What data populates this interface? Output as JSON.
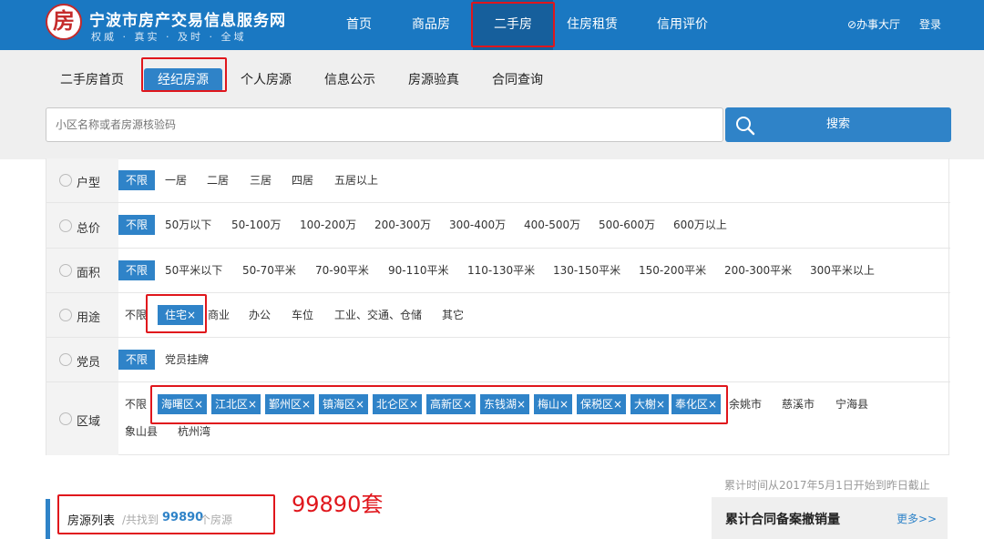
{
  "header": {
    "site_title": "宁波市房产交易信息服务网",
    "site_subtitle": "权威 · 真实 · 及时 · 全域",
    "logo_glyph": "房",
    "nav": [
      "首页",
      "商品房",
      "二手房",
      "住房租赁",
      "信用评价"
    ],
    "active_nav": "二手房",
    "office_hall": "⊘办事大厅",
    "login": "登录"
  },
  "subnav": {
    "items": [
      "二手房首页",
      "经纪房源",
      "个人房源",
      "信息公示",
      "房源验真",
      "合同查询"
    ],
    "active": "经纪房源"
  },
  "search": {
    "placeholder": "小区名称或者房源核验码",
    "button": "搜索"
  },
  "filters": {
    "huxing": {
      "label": "户型",
      "options": [
        "不限",
        "一居",
        "二居",
        "三居",
        "四居",
        "五居以上"
      ],
      "selected": "不限"
    },
    "price": {
      "label": "总价",
      "options": [
        "不限",
        "50万以下",
        "50-100万",
        "100-200万",
        "200-300万",
        "300-400万",
        "400-500万",
        "500-600万",
        "600万以上"
      ],
      "selected": "不限"
    },
    "area": {
      "label": "面积",
      "options": [
        "不限",
        "50平米以下",
        "50-70平米",
        "70-90平米",
        "90-110平米",
        "110-130平米",
        "130-150平米",
        "150-200平米",
        "200-300平米",
        "300平米以上"
      ],
      "selected": "不限"
    },
    "usage": {
      "label": "用途",
      "options": [
        "不限",
        "住宅×",
        "商业",
        "办公",
        "车位",
        "工业、交通、仓储",
        "其它"
      ],
      "selected": "住宅×"
    },
    "party": {
      "label": "党员",
      "options": [
        "不限",
        "党员挂牌"
      ],
      "selected": "不限"
    },
    "region": {
      "label": "区域",
      "unlimited": "不限",
      "selected_tags": [
        "海曙区×",
        "江北区×",
        "鄞州区×",
        "镇海区×",
        "北仑区×",
        "高新区×",
        "东钱湖×",
        "梅山×",
        "保税区×",
        "大榭×",
        "奉化区×"
      ],
      "others": [
        "余姚市",
        "慈溪市",
        "宁海县",
        "象山县",
        "杭州湾"
      ]
    }
  },
  "stats_note": "累计时间从2017年5月1日开始到昨日截止",
  "listing": {
    "title": "房源列表",
    "found_prefix": "/共找到",
    "count": "99890",
    "unit": "个房源",
    "annotation": "99890套"
  },
  "side": {
    "title": "累计合同备案撤销量",
    "more": "更多>>"
  },
  "colors": {
    "brand_blue": "#1a78c2",
    "button_blue": "#2f83c8",
    "highlight_red": "#e0161c"
  }
}
